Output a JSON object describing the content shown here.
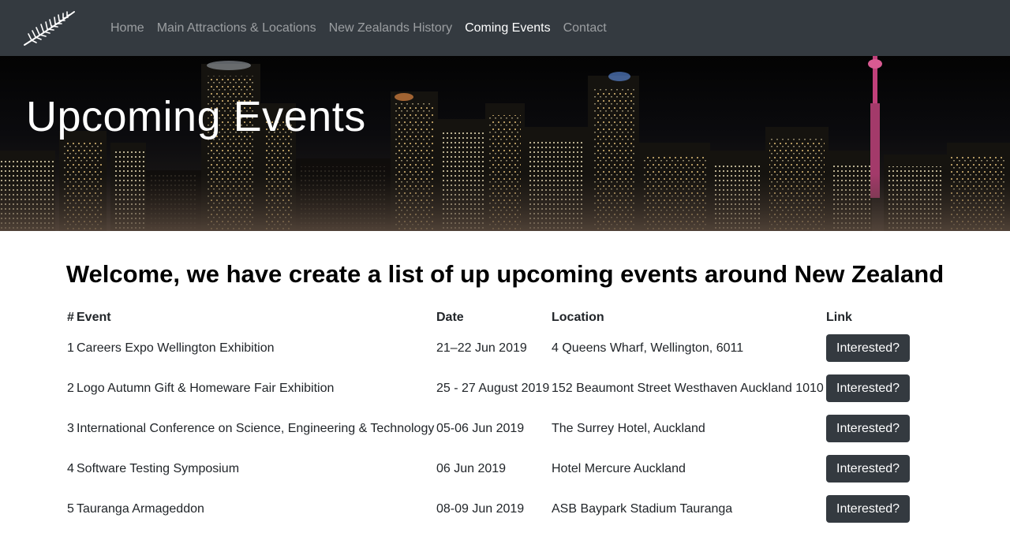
{
  "nav": {
    "items": [
      {
        "label": "Home",
        "active": false
      },
      {
        "label": "Main Attractions & Locations",
        "active": false
      },
      {
        "label": "New Zealands History",
        "active": false
      },
      {
        "label": "Coming Events",
        "active": true
      },
      {
        "label": "Contact",
        "active": false
      }
    ]
  },
  "hero": {
    "title": "Upcoming Events"
  },
  "main": {
    "welcome": "Welcome, we have create a list of up upcoming events around New Zealand",
    "table": {
      "headers": {
        "num": "#",
        "event": "Event",
        "date": "Date",
        "location": "Location",
        "link": "Link"
      },
      "rows": [
        {
          "num": "1",
          "event": "Careers Expo Wellington Exhibition",
          "date": "21–22 Jun 2019",
          "location": "4 Queens Wharf, Wellington, 6011",
          "button": "Interested?"
        },
        {
          "num": "2",
          "event": "Logo Autumn Gift & Homeware Fair Exhibition",
          "date": "25 - 27 August 2019",
          "location": "152 Beaumont Street Westhaven Auckland 1010",
          "button": "Interested?"
        },
        {
          "num": "3",
          "event": "International Conference on Science, Engineering & Technology",
          "date": "05-06 Jun 2019",
          "location": "The Surrey Hotel, Auckland",
          "button": "Interested?"
        },
        {
          "num": "4",
          "event": "Software Testing Symposium",
          "date": "06 Jun 2019",
          "location": "Hotel Mercure Auckland",
          "button": "Interested?"
        },
        {
          "num": "5",
          "event": "Tauranga Armageddon",
          "date": "08-09 Jun 2019",
          "location": "ASB Baypark Stadium Tauranga",
          "button": "Interested?"
        }
      ]
    }
  },
  "colors": {
    "navbar_bg": "#343a40",
    "button_bg": "#343a40",
    "nav_active": "#ffffff",
    "nav_inactive": "rgba(255,255,255,0.5)"
  },
  "icons": {
    "brand": "silver-fern-icon"
  }
}
